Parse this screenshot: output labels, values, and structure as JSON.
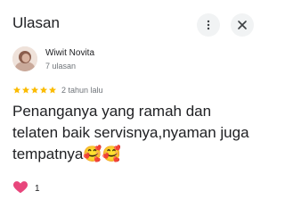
{
  "header": {
    "title": "Ulasan",
    "more_icon": "more-vertical-icon",
    "close_icon": "close-icon"
  },
  "reviewer": {
    "name": "Wiwit Novita",
    "meta": "7 ulasan"
  },
  "rating": {
    "stars": 5,
    "max_stars": 5,
    "star_color": "#fbbc04",
    "time": "2 tahun lalu"
  },
  "review": {
    "text": "Penanganya yang ramah dan telaten baik servisnya,nyaman juga tempatnya🥰🥰"
  },
  "reaction": {
    "icon": "heart-icon",
    "color": "#e8467c",
    "count": "1"
  }
}
